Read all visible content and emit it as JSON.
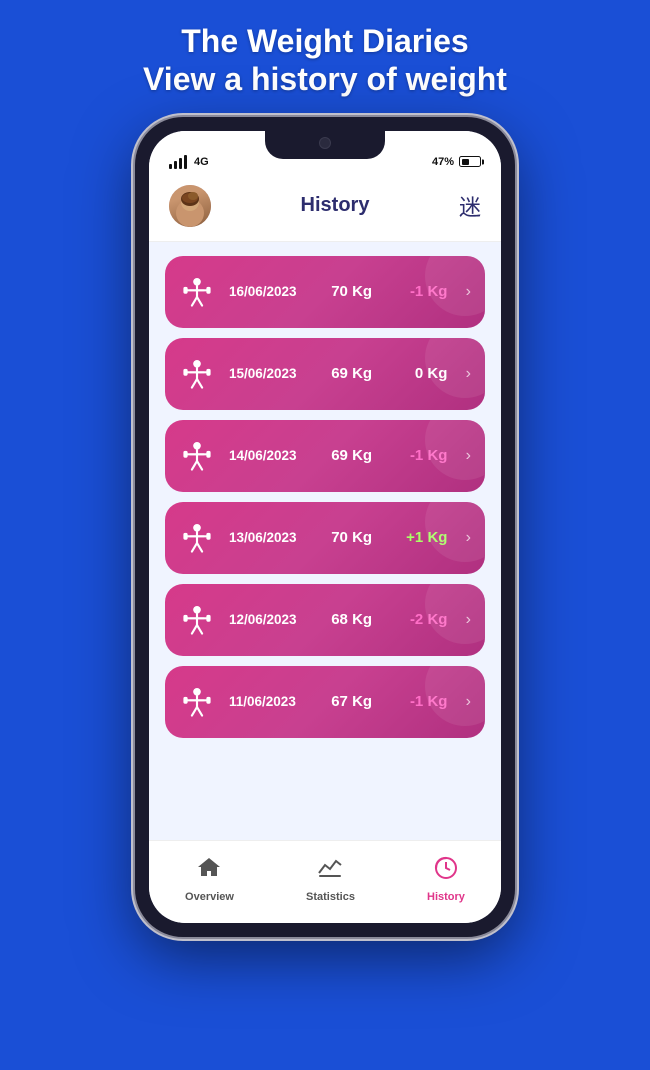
{
  "app": {
    "title_line1": "The Weight Diaries",
    "title_line2": "View a history of weight"
  },
  "status_bar": {
    "signal": "4G",
    "battery_percent": "47%"
  },
  "header": {
    "title": "History",
    "translate_icon": "translate"
  },
  "entries": [
    {
      "date": "16/06/2023",
      "weight": "70 Kg",
      "delta": "-1 Kg",
      "delta_type": "negative"
    },
    {
      "date": "15/06/2023",
      "weight": "69 Kg",
      "delta": "0 Kg",
      "delta_type": "zero"
    },
    {
      "date": "14/06/2023",
      "weight": "69 Kg",
      "delta": "-1 Kg",
      "delta_type": "negative"
    },
    {
      "date": "13/06/2023",
      "weight": "70 Kg",
      "delta": "+1 Kg",
      "delta_type": "positive"
    },
    {
      "date": "12/06/2023",
      "weight": "68 Kg",
      "delta": "-2 Kg",
      "delta_type": "negative"
    },
    {
      "date": "11/06/2023",
      "weight": "67 Kg",
      "delta": "-1 Kg",
      "delta_type": "negative"
    }
  ],
  "nav": {
    "items": [
      {
        "label": "Overview",
        "icon": "home",
        "active": false
      },
      {
        "label": "Statistics",
        "icon": "statistics",
        "active": false
      },
      {
        "label": "History",
        "icon": "history",
        "active": true
      }
    ]
  }
}
